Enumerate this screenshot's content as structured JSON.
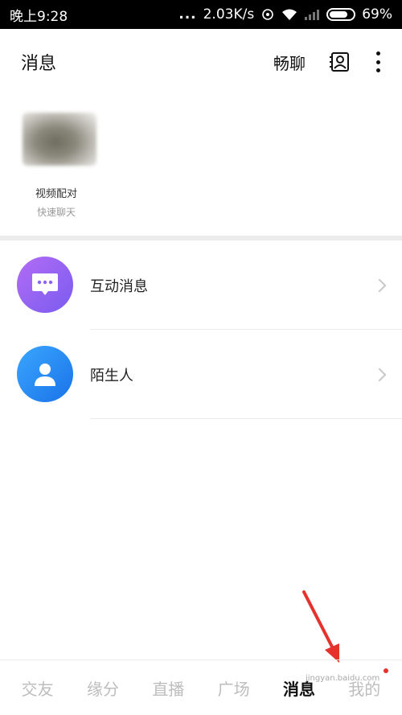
{
  "status_bar": {
    "time": "晚上9:28",
    "dots": "...",
    "speed": "2.03K/s",
    "battery": "69%"
  },
  "header": {
    "title": "消息",
    "chat_link": "畅聊"
  },
  "match": {
    "label": "视频配对",
    "sub": "快速聊天"
  },
  "list": [
    {
      "label": "互动消息",
      "icon": "chat-bubble-icon"
    },
    {
      "label": "陌生人",
      "icon": "person-icon"
    }
  ],
  "bottom_nav": {
    "items": [
      "交友",
      "缘分",
      "直播",
      "广场",
      "消息",
      "我的"
    ],
    "active": "消息"
  },
  "watermark": "jingyan.baidu.com",
  "colors": {
    "interact_avatar": "#8e63f3",
    "stranger_avatar": "#2a8cf5",
    "annotation_arrow": "#e5322d",
    "badge_dot": "#e5322d"
  }
}
